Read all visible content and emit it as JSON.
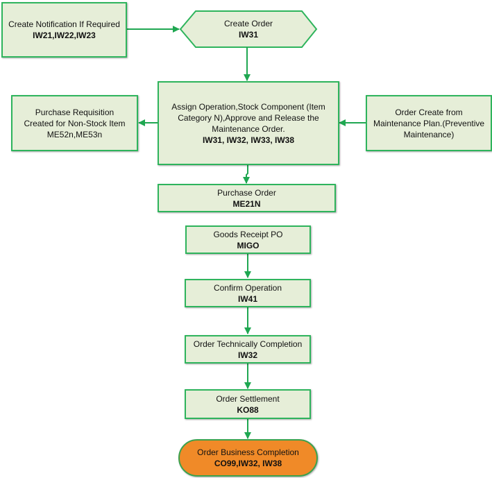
{
  "colors": {
    "node_fill": "#e6eed8",
    "node_border": "#2eb45c",
    "connector": "#1fa751",
    "final_fill": "#f08a28",
    "final_border": "#3ba24e"
  },
  "nodes": {
    "create_notification": {
      "label": "Create Notification If Required",
      "code": "IW21,IW22,IW23"
    },
    "create_order": {
      "label": "Create Order",
      "code": "IW31"
    },
    "assign_operation": {
      "label_lines": [
        "Assign Operation,Stock Component (Item",
        "Category N),Approve and Release the",
        "Maintenance Order."
      ],
      "code": "IW31, IW32, IW33, IW38"
    },
    "purchase_requisition": {
      "label_lines": [
        "Purchase Requisition",
        "Created for Non-Stock Item",
        "ME52n,ME53n"
      ]
    },
    "maintenance_plan": {
      "label_lines": [
        "Order Create from",
        "Maintenance Plan.(Preventive",
        "Maintenance)"
      ]
    },
    "purchase_order": {
      "label": "Purchase Order",
      "code": "ME21N"
    },
    "goods_receipt": {
      "label": "Goods Receipt PO",
      "code": "MIGO"
    },
    "confirm_operation": {
      "label": "Confirm Operation",
      "code": "IW41"
    },
    "technical_completion": {
      "label": "Order Technically Completion",
      "code": "IW32"
    },
    "order_settlement": {
      "label": "Order Settlement",
      "code": "KO88"
    },
    "business_completion": {
      "label": "Order Business Completion",
      "code": "CO99,IW32, IW38"
    }
  },
  "edges": [
    {
      "from": "create_notification",
      "to": "create_order"
    },
    {
      "from": "create_order",
      "to": "assign_operation"
    },
    {
      "from": "assign_operation",
      "to": "purchase_requisition"
    },
    {
      "from": "maintenance_plan",
      "to": "assign_operation"
    },
    {
      "from": "assign_operation",
      "to": "purchase_order"
    },
    {
      "from": "goods_receipt",
      "to": "confirm_operation"
    },
    {
      "from": "confirm_operation",
      "to": "technical_completion"
    },
    {
      "from": "technical_completion",
      "to": "order_settlement"
    },
    {
      "from": "order_settlement",
      "to": "business_completion"
    }
  ]
}
